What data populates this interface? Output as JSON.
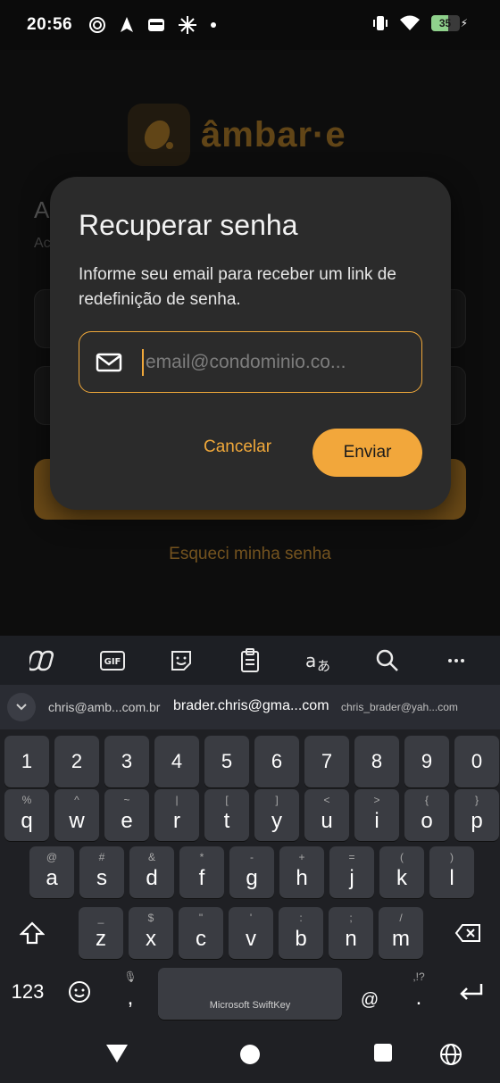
{
  "status_bar": {
    "time": "20:56",
    "battery_level": "35",
    "battery_percent": 35
  },
  "background": {
    "logo_text": "âmbar·e",
    "heading_partial": "A",
    "subtext_partial": "Ac",
    "forgot_link": "Esqueci minha senha"
  },
  "dialog": {
    "title": "Recuperar senha",
    "description": "Informe seu email para receber um link de redefinição de senha.",
    "email_placeholder": "email@condominio.co...",
    "email_value": "",
    "cancel_label": "Cancelar",
    "send_label": "Enviar"
  },
  "keyboard": {
    "toolbar": [
      "copilot-icon",
      "gif-icon",
      "sticker-icon",
      "clipboard-icon",
      "translate-icon",
      "search-icon",
      "more-icon"
    ],
    "suggestions": [
      "chris@amb...com.br",
      "brader.chris@gma...com",
      "chris_brader@yah...com"
    ],
    "number_row": [
      "1",
      "2",
      "3",
      "4",
      "5",
      "6",
      "7",
      "8",
      "9",
      "0"
    ],
    "row1": [
      {
        "key": "q",
        "sub": "%"
      },
      {
        "key": "w",
        "sub": "^"
      },
      {
        "key": "e",
        "sub": "~"
      },
      {
        "key": "r",
        "sub": "|"
      },
      {
        "key": "t",
        "sub": "["
      },
      {
        "key": "y",
        "sub": "]"
      },
      {
        "key": "u",
        "sub": "<"
      },
      {
        "key": "i",
        "sub": ">"
      },
      {
        "key": "o",
        "sub": "{"
      },
      {
        "key": "p",
        "sub": "}"
      }
    ],
    "row2": [
      {
        "key": "a",
        "sub": "@"
      },
      {
        "key": "s",
        "sub": "#"
      },
      {
        "key": "d",
        "sub": "&"
      },
      {
        "key": "f",
        "sub": "*"
      },
      {
        "key": "g",
        "sub": "-"
      },
      {
        "key": "h",
        "sub": "+"
      },
      {
        "key": "j",
        "sub": "="
      },
      {
        "key": "k",
        "sub": "("
      },
      {
        "key": "l",
        "sub": ")"
      }
    ],
    "row3": [
      {
        "key": "z",
        "sub": "_"
      },
      {
        "key": "x",
        "sub": "$"
      },
      {
        "key": "c",
        "sub": "\""
      },
      {
        "key": "v",
        "sub": "'"
      },
      {
        "key": "b",
        "sub": ":"
      },
      {
        "key": "n",
        "sub": ";"
      },
      {
        "key": "m",
        "sub": "/"
      }
    ],
    "num_toggle": "123",
    "comma": ",",
    "space_label": "Microsoft SwiftKey",
    "at": "@",
    "period": ".",
    "period_sub": ",!?"
  }
}
